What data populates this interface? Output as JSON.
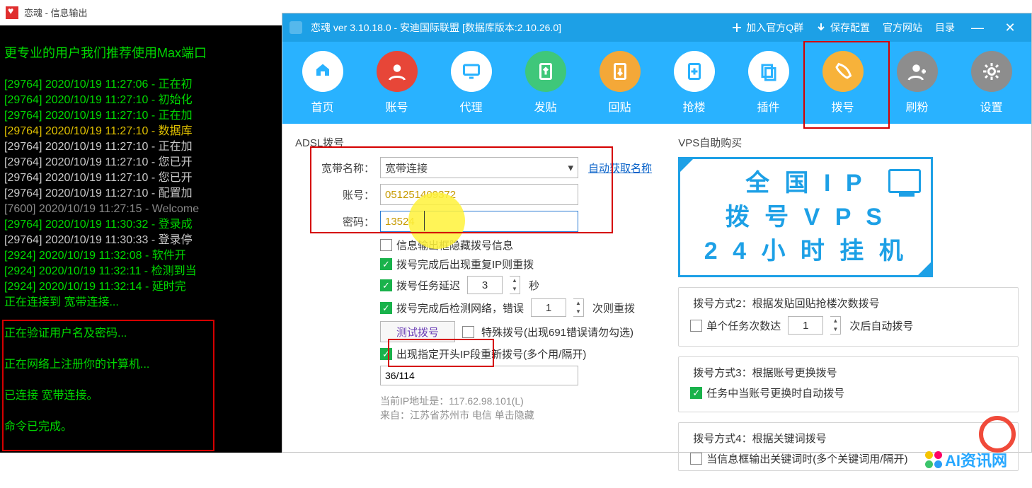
{
  "console": {
    "title": "恋魂 - 信息输出",
    "headline": "更专业的用户我们推荐使用Max端口",
    "lines": [
      {
        "c": "green",
        "t": "[29764] 2020/10/19 11:27:06 - 正在初"
      },
      {
        "c": "green",
        "t": "[29764] 2020/10/19 11:27:10 - 初始化"
      },
      {
        "c": "green",
        "t": "[29764] 2020/10/19 11:27:10 - 正在加"
      },
      {
        "c": "yellow",
        "t": "[29764] 2020/10/19 11:27:10 - 数据库"
      },
      {
        "c": "white",
        "t": "[29764] 2020/10/19 11:27:10 - 正在加"
      },
      {
        "c": "white",
        "t": "[29764] 2020/10/19 11:27:10 - 您已开"
      },
      {
        "c": "white",
        "t": "[29764] 2020/10/19 11:27:10 - 您已开"
      },
      {
        "c": "white",
        "t": "[29764] 2020/10/19 11:27:10 - 配置加"
      },
      {
        "c": "grey",
        "t": "[7600] 2020/10/19 11:27:15 - Welcome"
      },
      {
        "c": "green",
        "t": "[29764] 2020/10/19 11:30:32 - 登录成"
      },
      {
        "c": "white",
        "t": "[29764] 2020/10/19 11:30:33 - 登录停"
      },
      {
        "c": "green",
        "t": "[2924] 2020/10/19 11:32:08 - 软件开"
      },
      {
        "c": "green",
        "t": "[2924] 2020/10/19 11:32:11 - 检测到当"
      },
      {
        "c": "green",
        "t": "[2924] 2020/10/19 11:32:14 - 延时完"
      },
      {
        "c": "green",
        "t": "正在连接到 宽带连接..."
      },
      {
        "c": "green",
        "t": ""
      },
      {
        "c": "green",
        "t": "正在验证用户名及密码..."
      },
      {
        "c": "green",
        "t": ""
      },
      {
        "c": "green",
        "t": "正在网络上注册你的计算机..."
      },
      {
        "c": "green",
        "t": ""
      },
      {
        "c": "green",
        "t": "已连接 宽带连接。"
      },
      {
        "c": "green",
        "t": ""
      },
      {
        "c": "green",
        "t": "命令已完成。"
      }
    ]
  },
  "menubar": {
    "title": "恋魂 ver 3.10.18.0 - 安迪国际联盟 [数据库版本:2.10.26.0]",
    "m_join": "加入官方Q群",
    "m_save": "保存配置",
    "m_site": "官方网站",
    "m_dir": "目录"
  },
  "toolbar": {
    "items": [
      {
        "label": "首页",
        "tone": "",
        "icon": "home"
      },
      {
        "label": "账号",
        "tone": "red",
        "icon": "user"
      },
      {
        "label": "代理",
        "tone": "",
        "icon": "monitor"
      },
      {
        "label": "发贴",
        "tone": "green",
        "icon": "upload"
      },
      {
        "label": "回贴",
        "tone": "orange",
        "icon": "download"
      },
      {
        "label": "抢楼",
        "tone": "",
        "icon": "plus-doc"
      },
      {
        "label": "插件",
        "tone": "",
        "icon": "copy"
      },
      {
        "label": "拨号",
        "tone": "orange2",
        "icon": "phone"
      },
      {
        "label": "刷粉",
        "tone": "grey",
        "icon": "user-add"
      },
      {
        "label": "设置",
        "tone": "grey",
        "icon": "gear"
      }
    ]
  },
  "adsl": {
    "section": "ADSL拨号",
    "name_lbl": "宽带名称：",
    "name_val": "宽带连接",
    "name_auto": "自动获取名称",
    "acct_lbl": "账号：",
    "acct_val": "051251409372",
    "pw_lbl": "密码：",
    "pw_val": "13524",
    "chk_hideinfo": "信息输出框隐藏拨号信息",
    "chk_repeat": "拨号完成后出现重复IP则重拨",
    "chk_delay_pre": "拨号任务延迟",
    "delay_val": "3",
    "delay_suf": "秒",
    "chk_net_pre": "拨号完成后检测网络，错误",
    "net_val": "1",
    "net_suf": "次则重拨",
    "btn_test": "测试拨号",
    "chk_special": "特殊拨号(出现691错误请勿勾选)",
    "chk_ipseg": "出现指定开头IP段重新拨号(多个用/隔开)",
    "ipseg_val": "36/114",
    "ip_line": "当前IP地址是：117.62.98.101(L)",
    "from_line": "来自：江苏省苏州市 电信  单击隐藏"
  },
  "right": {
    "section": "VPS自助购买",
    "banner1": "全 国 I P",
    "banner2": "拨 号 V P S",
    "banner3": "2 4 小 时 挂 机",
    "g2_title": "拨号方式2：根据发贴回贴抢楼次数拨号",
    "g2_chk": "单个任务次数达",
    "g2_val": "1",
    "g2_suf": "次后自动拨号",
    "g3_title": "拨号方式3：根据账号更换拨号",
    "g3_chk": "任务中当账号更换时自动拨号",
    "g4_title": "拨号方式4：根据关键词拨号",
    "g4_chk": "当信息框输出关键词时(多个关键词用/隔开)"
  },
  "watermark": "AI资讯网"
}
